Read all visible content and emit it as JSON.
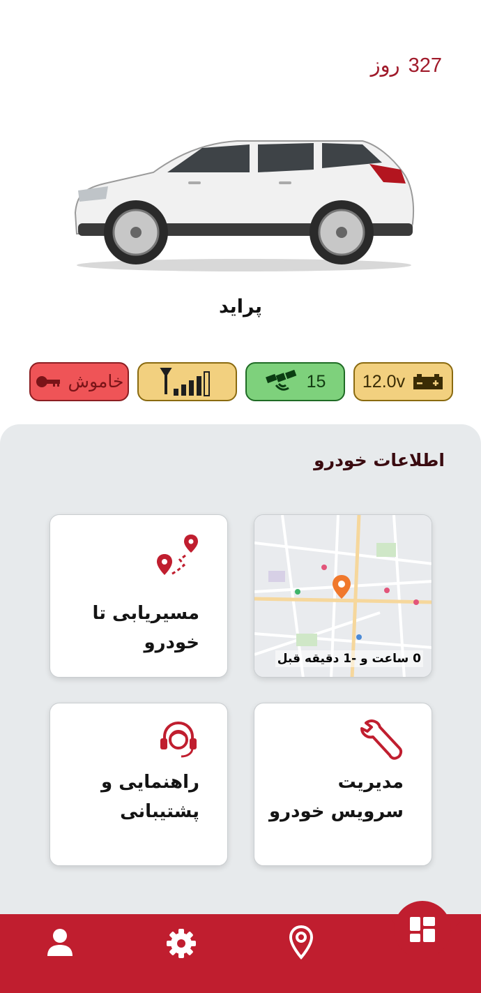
{
  "header": {
    "days_value": "327",
    "days_unit": "روز"
  },
  "vehicle": {
    "name": "پراید"
  },
  "status": {
    "engine_label": "خاموش",
    "gps_satellites": "15",
    "battery_voltage": "12.0v",
    "signal_bars": 5
  },
  "panel": {
    "title": "اطلاعات خودرو",
    "cards": {
      "map_caption": "0 ساعت و -1 دقیقه قبل",
      "route_line1": "مسیریابی تا",
      "route_line2": "خودرو",
      "service_line1": "مدیریت",
      "service_line2": "سرویس خودرو",
      "support_line1": "راهنمایی و",
      "support_line2": "پشتیبانی"
    }
  },
  "nav": {
    "items": [
      "profile-icon",
      "settings-icon",
      "location-icon",
      "dashboard-icon"
    ]
  },
  "colors": {
    "accent": "#c01e2f",
    "engine_off": "#ef5457",
    "gps_ok": "#7ed17c",
    "warning": "#f2d07f"
  }
}
